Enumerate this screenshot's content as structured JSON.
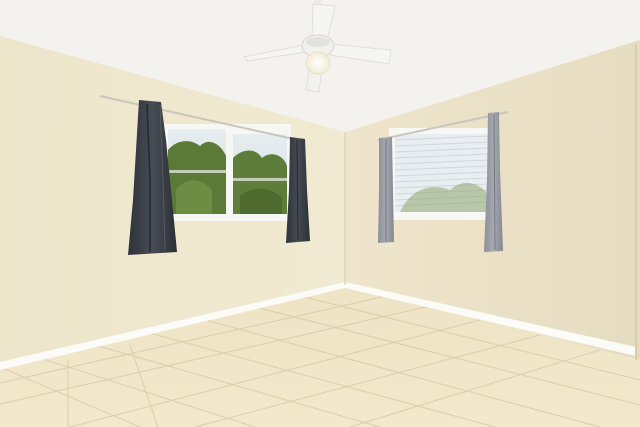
{
  "scene": {
    "subject": "empty-room",
    "colors": {
      "ceiling": "#f3f2ee",
      "left_wall": "#efe8cf",
      "back_wall": "#ede4cb",
      "right_wall": "#ebe2c8",
      "floor_tile": "#f2e4c6",
      "grout": "#ddd0b0",
      "baseboard": "#fbfbf8",
      "curtain": "#3f444c",
      "curtain_light": "#9d9fa8",
      "sky": "#dfe9f0",
      "foliage": "#5f7d3a",
      "blind": "#e9eef2",
      "fan_body": "#f1f1ef",
      "fan_light": "#fffbe8"
    },
    "icons": [
      "ceiling-fan-icon"
    ]
  }
}
